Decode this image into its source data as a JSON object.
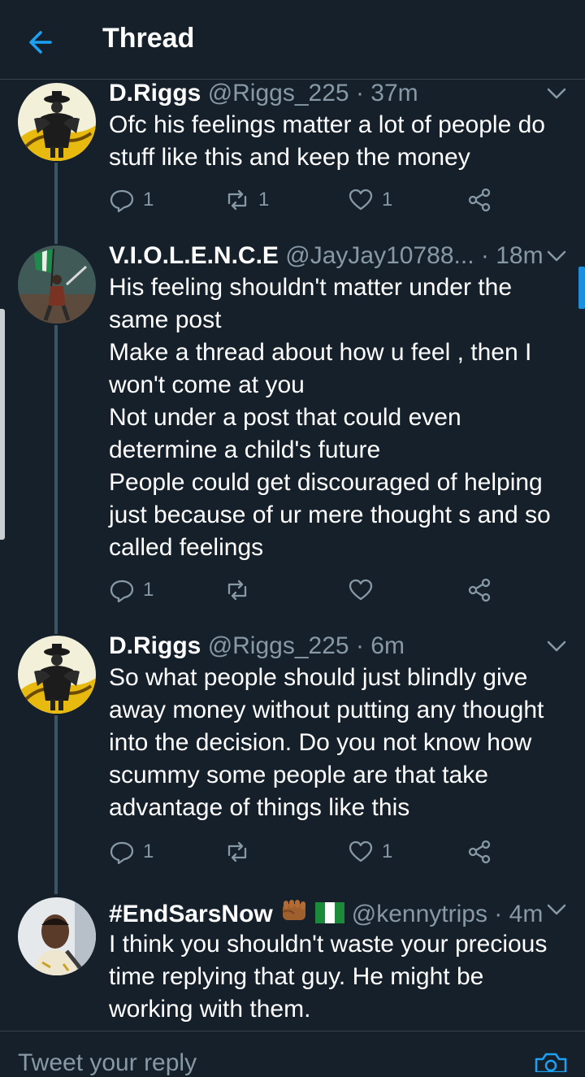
{
  "header": {
    "title": "Thread"
  },
  "tweets": [
    {
      "name": "D.Riggs",
      "handle": "@Riggs_225",
      "dot": "·",
      "time": "37m",
      "lines": [
        "Ofc his feelings matter a lot of people do",
        "stuff like this and keep the money"
      ],
      "reply_count": "1",
      "retweet_count": "1",
      "like_count": "1"
    },
    {
      "name": "V.I.O.L.E.N.C.E",
      "handle": "@JayJay10788...",
      "dot": "·",
      "time": "18m",
      "lines": [
        "His feeling shouldn't matter under the",
        "same post",
        "Make a thread about how u feel , then I",
        "won't come at you",
        "Not under a post that could even",
        "determine a child's future",
        "People could get discouraged of helping",
        "just because of ur mere thought s and so",
        "called feelings"
      ],
      "reply_count": "1",
      "retweet_count": "",
      "like_count": ""
    },
    {
      "name": "D.Riggs",
      "handle": "@Riggs_225",
      "dot": "·",
      "time": "6m",
      "lines": [
        "So what people should just blindly give",
        "away money without putting any thought",
        "into the decision. Do you not know how",
        "scummy some people are that take",
        "advantage of things like this"
      ],
      "reply_count": "1",
      "retweet_count": "",
      "like_count": "1"
    },
    {
      "name": "#EndSarsNow",
      "handle": "@kennytrips",
      "dot": "·",
      "time": "4m",
      "lines": [
        "I think you shouldn't waste your precious",
        "time replying that guy. He might be",
        "working with them."
      ]
    }
  ],
  "reply_bar": {
    "placeholder": "Tweet your reply"
  },
  "colors": {
    "background": "#15202b",
    "accent": "#1da1f2",
    "muted": "#8899a6",
    "thread_line": "#3d5466"
  },
  "icons": [
    "back-arrow-icon",
    "chevron-down-icon",
    "reply-icon",
    "retweet-icon",
    "like-icon",
    "share-icon",
    "camera-icon"
  ]
}
